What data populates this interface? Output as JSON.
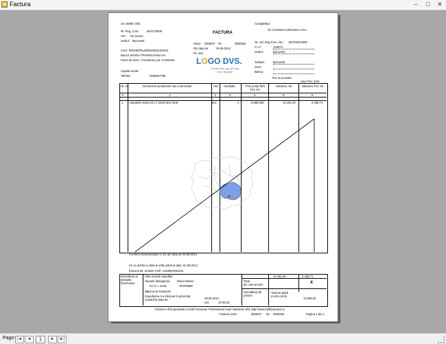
{
  "window": {
    "title": "Factura",
    "min": "–",
    "max": "□",
    "close": "✕"
  },
  "statusbar": {
    "page_label": "Page:",
    "page_value": "1",
    "first": "|◄",
    "prev": "◄",
    "next": "►",
    "last": "►|"
  },
  "invoice": {
    "seller": {
      "name": "SC DEMO SRL",
      "reg_com_label": "Nr. Reg. Com.:",
      "reg_com": "J40/17/2009",
      "cif_label": "CIF:",
      "cif": "Ro 111111",
      "sediu_label": "Sediul:",
      "sediu": "Bucuresti",
      "cont_label": "Cont:",
      "cont": "RO04BTRL0400120201354XX",
      "banca_label": "Banca:",
      "banca": "BANCA TRANSILVANIA SA",
      "punct_label": "Punct de lucru:",
      "punct": "Constanta, jud. Constanta",
      "capital_label": "Capital social:",
      "telefon_label": "Telefon:",
      "telefon": "0555667788"
    },
    "header": {
      "title": "FACTURA",
      "serie_label": "Seria:",
      "serie": "DEMOF",
      "nr_label": "Nr.:",
      "nr": "0000062",
      "data_label": "Din data de",
      "data": "29.08.2014",
      "aviz_label": "Nr. aviz:"
    },
    "logo": {
      "text_a": "L",
      "text_b": "O",
      "text_c": "GO DVS.",
      "sub1": "format: bmp, jpg, gif, png",
      "sub2": "316 x 55 pixeli"
    },
    "buyer": {
      "label": "Cumpărător:",
      "name": "SC Contrast Architecture S.R.L.",
      "reg_label": "Nr. ord. Reg.Com. /an:",
      "reg": "J40/7081/2005",
      "cif_label": "C.I.F.:",
      "cif": "123974",
      "sediu_label": "Sediul:",
      "sediu": "Bucuresti",
      "judet_label": "Judeţul:",
      "judet": "Bucuresti",
      "cont_label": "Cont:",
      "banca_label": "Banca:"
    },
    "cota_tva_label": "TVA la incasare",
    "cota_tva": "cota TVA: 24%",
    "table": {
      "headers": [
        "Nr. crt.",
        "Denumirea produselor sau a serviciilor",
        "UM",
        "Cantitate",
        "Preţ unitar fără TVA -lei-",
        "Valoarea -lei-",
        "Valoarea TVA -lei-"
      ],
      "numbers": [
        "0",
        "1",
        "2",
        "3",
        "4",
        "5",
        "6"
      ],
      "rows": [
        {
          "nr": "1.",
          "denumire": "Autodesk AutoCAD LT 2015 New SLM",
          "um": "buc",
          "cant": "2",
          "pret": "5.080,645",
          "valoare": "10.161,29",
          "tva": "2.438,71"
        }
      ]
    },
    "notes": {
      "line1": "Conform documentului nr. 34, din data de 29.08.2014",
      "line2": "Se va achita cu bilet la ordin până la data: 01.09.2014",
      "line3": "Întocmit de: emitent CNP: 1234567891234"
    },
    "footer": {
      "sig_label": "Semnătura şi ştampila furnizorului",
      "exped_title": "Date privind expediţia:",
      "delegat_label": "Numele delegatului:",
      "delegat": "Elena Rotaru",
      "bi_label": "B.I./C.I. seria:",
      "bi": "TR375899",
      "mijloc_label": "Mijlocul de transport:",
      "expedierea_label": "Expedierea s-a efectuat în prezenţa noastră la data de:",
      "exp_date": "29.08.2014",
      "ora_label": "ora:",
      "ora": "10:45:18",
      "total_label": "Total",
      "total_val": "10.161,29",
      "total_tva": "2.438,71",
      "accept_label": "din care accize:",
      "accept_mark": "X",
      "sig_primire": "Semnătura de primire",
      "total_plata_label": "Total de plată (col.5+col.6)",
      "total_plata": "12.600,00"
    },
    "generated": "Factura a fost generata cu Soft Facturare Professional Autor DataSolv SRL http://www.softfacturare.ro",
    "bottom": {
      "serie_label": "Factura seria:",
      "serie": "DEMOF",
      "nr_label": "Nr.:",
      "nr": "0000062",
      "page": "Pagina 1 din 1"
    }
  }
}
